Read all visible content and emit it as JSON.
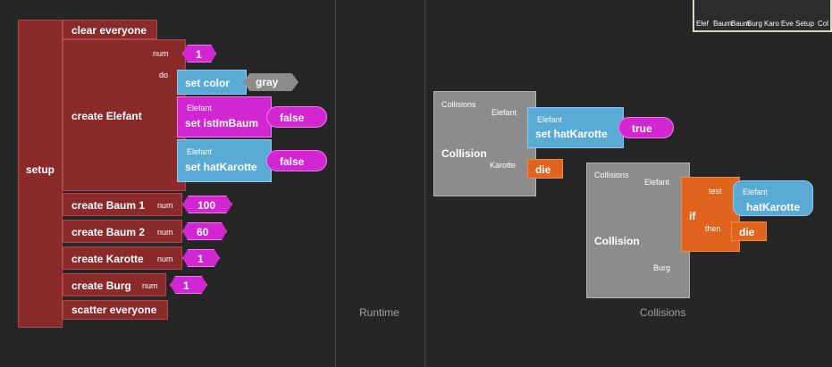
{
  "panes": {
    "runtime_label": "Runtime",
    "collisions_label": "Collisions"
  },
  "setup": {
    "label": "setup",
    "clear": "clear everyone",
    "create_elefant": "create Elefant",
    "num_label": "num",
    "do_label": "do",
    "elefant_num": "1",
    "set_color": "set color",
    "color_value": "gray",
    "elefant_tag": "Elefant",
    "set_istimbaum": "set istImBaum",
    "istimbaum_value": "false",
    "set_hatkarotte": "set hatKarotte",
    "hatkarotte_value": "false",
    "create_baum1": "create Baum 1",
    "baum1_num": "100",
    "create_baum2": "create Baum 2",
    "baum2_num": "60",
    "create_karotte": "create Karotte",
    "karotte_num": "1",
    "create_burg": "create Burg",
    "burg_num": "1",
    "scatter": "scatter everyone"
  },
  "collision1": {
    "header": "Collisions",
    "agent1": "Elefant",
    "title": "Collision",
    "agent2": "Karotte",
    "set_tag": "Elefant",
    "set_label": "set hatKarotte",
    "set_value": "true",
    "die": "die"
  },
  "collision2": {
    "header": "Collisions",
    "agent1": "Elefant",
    "title": "Collision",
    "agent2": "Burg",
    "if_label": "if",
    "test_label": "test",
    "then_label": "then",
    "cond_tag": "Elefant",
    "cond_label": "hatKarotte",
    "die": "die"
  },
  "minimap": {
    "items": [
      "Elef",
      "Baum",
      "Baum",
      "Burg",
      "Karo",
      "Eve",
      "Setup",
      "Col"
    ]
  },
  "colors": {
    "background": "#262626",
    "setup_red": "#8b2a2a",
    "number_magenta": "#d226d2",
    "agent_blue": "#5aaad6",
    "die_orange": "#e0641e",
    "collision_gray": "#8c8c8c"
  }
}
